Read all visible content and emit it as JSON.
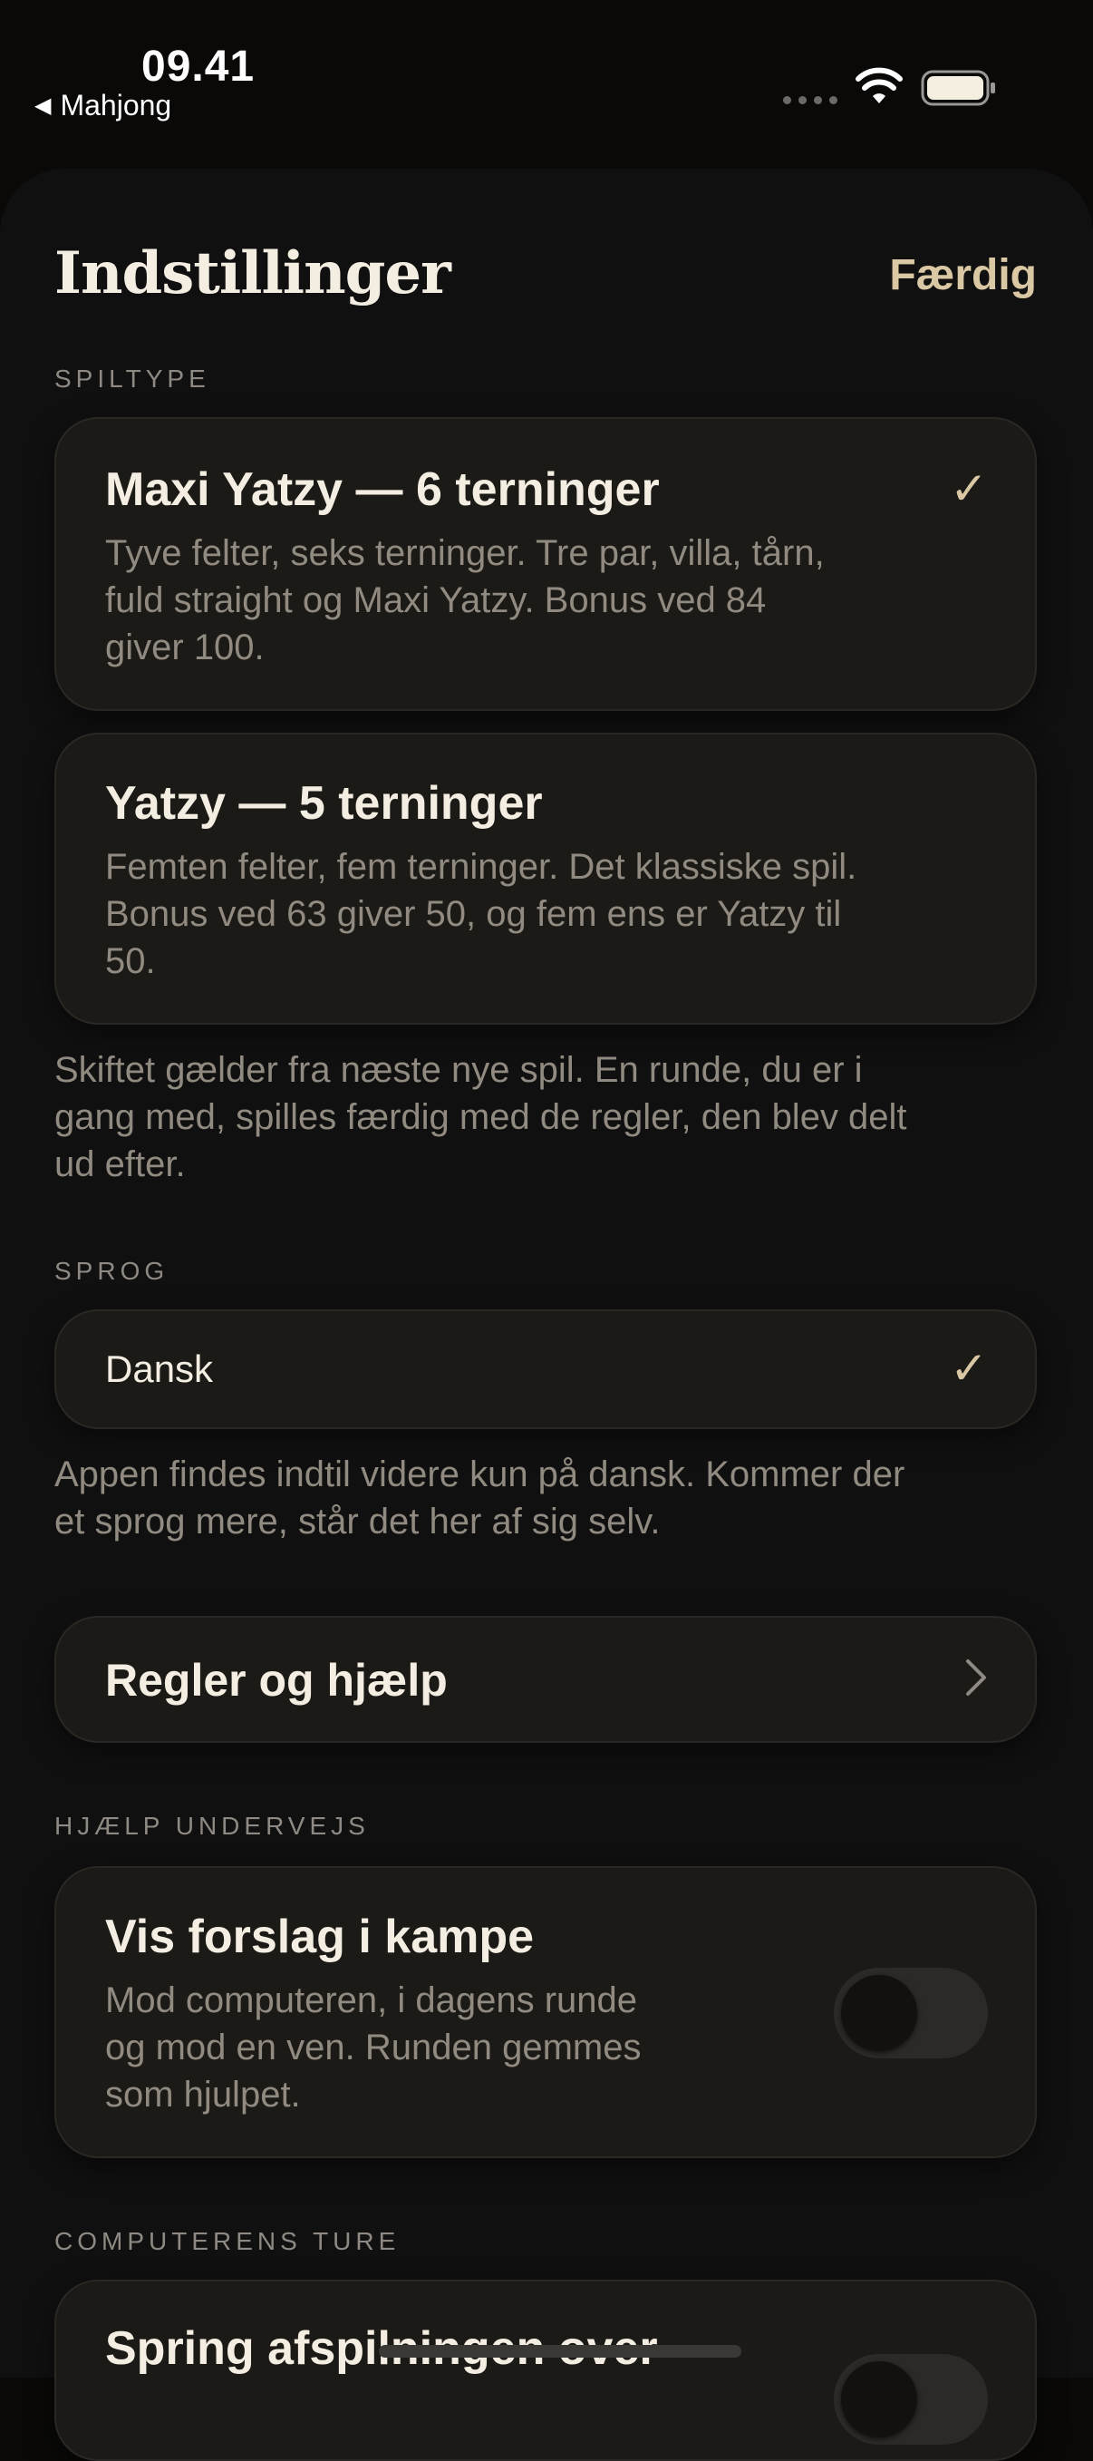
{
  "status_bar": {
    "time": "09.41",
    "back_app": "Mahjong"
  },
  "header": {
    "title": "Indstillinger",
    "done_label": "Færdig"
  },
  "game_type": {
    "section_label": "SPILTYPE",
    "options": [
      {
        "title": "Maxi Yatzy — 6 terninger",
        "desc_lines": [
          "Tyve felter, seks terninger. Tre par, villa, tårn,",
          "fuld straight og Maxi Yatzy. Bonus ved 84",
          "giver 100."
        ],
        "selected": true
      },
      {
        "title": "Yatzy — 5 terninger",
        "desc_lines": [
          "Femten felter, fem terninger. Det klassiske spil.",
          "Bonus ved 63 giver 50, og fem ens er Yatzy til",
          "50."
        ],
        "selected": false
      }
    ],
    "note_lines": [
      "Skiftet gælder fra næste nye spil. En runde, du er i",
      "gang med, spilles færdig med de regler, den blev delt",
      "ud efter."
    ]
  },
  "language": {
    "section_label": "SPROG",
    "selected": "Dansk",
    "note_lines": [
      "Appen findes indtil videre kun på dansk. Kommer der",
      "et sprog mere, står det her af sig selv."
    ]
  },
  "rules": {
    "label": "Regler og hjælp"
  },
  "hints": {
    "section_label": "HJÆLP UNDERVEJS",
    "title": "Vis forslag i kampe",
    "desc_lines": [
      "Mod computeren, i dagens runde",
      "og mod en ven. Runden gemmes",
      "som hjulpet."
    ],
    "enabled": false
  },
  "computer_turns": {
    "section_label": "COMPUTERENS TURE",
    "title": "Spring afspilningen over"
  },
  "colors": {
    "accent": "#d9c8a3",
    "card_bg": "#1c1a17",
    "sheet_bg": "#111010",
    "muted_text": "#908a80"
  }
}
